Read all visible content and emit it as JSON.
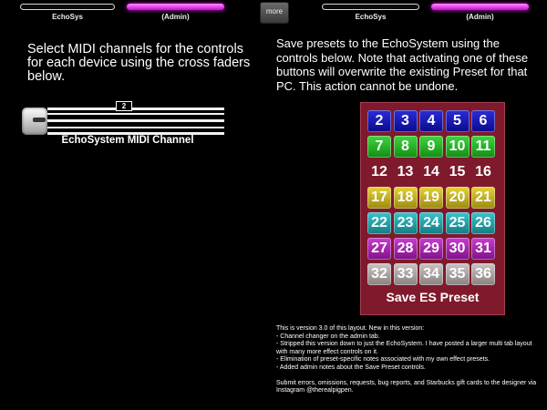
{
  "tabs": [
    {
      "label": "EchoSys",
      "style": "white"
    },
    {
      "label": "(Admin)",
      "style": "pink"
    },
    {
      "label": "EchoSys",
      "style": "white"
    },
    {
      "label": "(Admin)",
      "style": "pink"
    }
  ],
  "more_label": "more",
  "midi": {
    "heading": "Select MIDI channels for the controls for each device using the cross faders below.",
    "fader_value": "2",
    "fader_label": "EchoSystem MIDI Channel"
  },
  "presets": {
    "heading": "Save presets to the EchoSystem using the controls below.   Note that activating one of these buttons will overwrite the existing Preset for that PC.   This action cannot be undone.",
    "rows": [
      {
        "color": "blue",
        "labels": [
          "2",
          "3",
          "4",
          "5",
          "6"
        ]
      },
      {
        "color": "green",
        "labels": [
          "7",
          "8",
          "9",
          "10",
          "11"
        ]
      },
      {
        "color": "red",
        "labels": [
          "12",
          "13",
          "14",
          "15",
          "16"
        ]
      },
      {
        "color": "yellow",
        "labels": [
          "17",
          "18",
          "19",
          "20",
          "21"
        ]
      },
      {
        "color": "cyan",
        "labels": [
          "22",
          "23",
          "24",
          "25",
          "26"
        ]
      },
      {
        "color": "magenta",
        "labels": [
          "27",
          "28",
          "29",
          "30",
          "31"
        ]
      },
      {
        "color": "gray",
        "labels": [
          "32",
          "33",
          "34",
          "35",
          "36"
        ]
      }
    ],
    "save_label": "Save ES Preset"
  },
  "notes": {
    "lines": [
      "This is version 3.0 of this layout.    New in this version:",
      "- Channel changer on the admin tab.",
      "- Stripped this version down to just the EchoSystem.   I have posted a larger multi tab layout with many more effect controls on it.",
      "- Elimination of preset-specific notes associated with my own effect presets.",
      "- Added admin notes about the Save Preset controls."
    ],
    "footer": "Submit errors, omissions, requests, bug reports, and Starbucks gift cards to the designer via Instagram @therealpigpen."
  }
}
